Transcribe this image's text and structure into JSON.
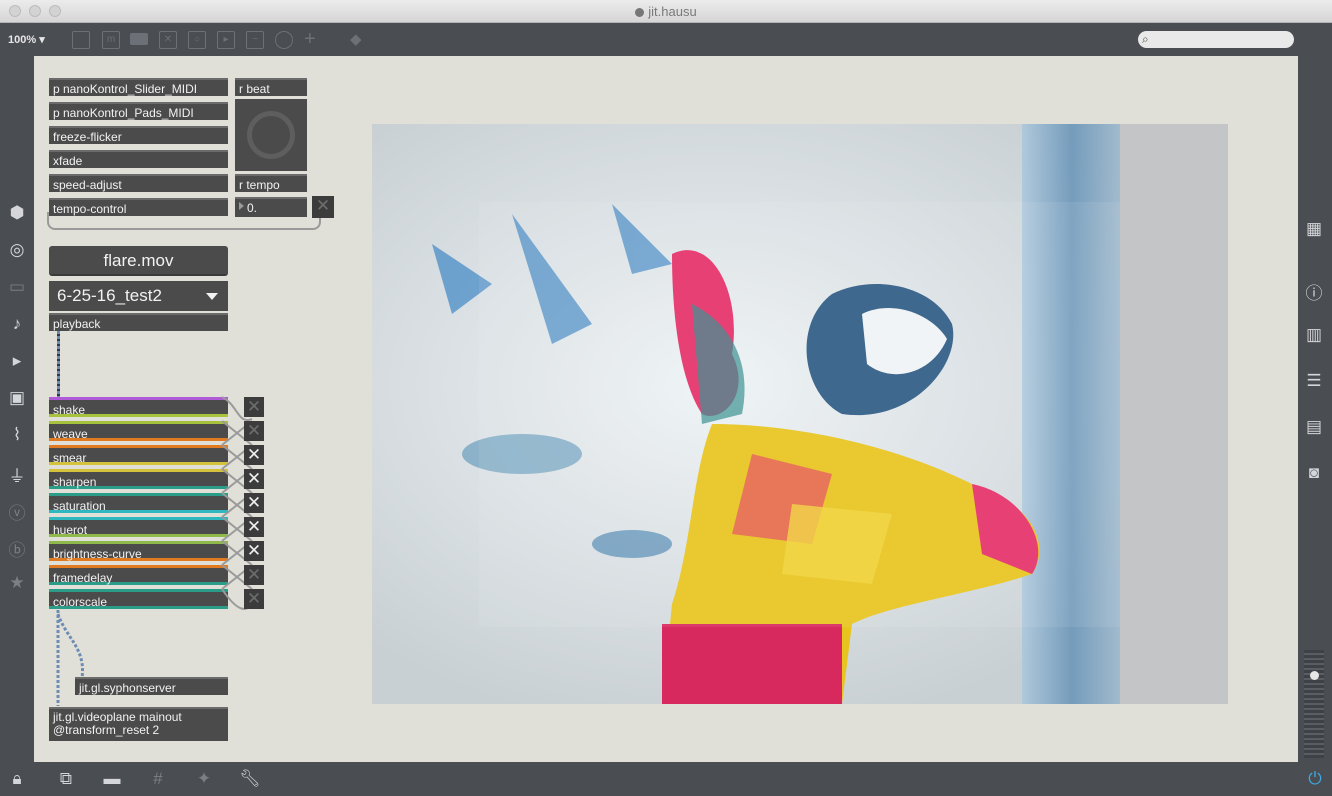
{
  "window": {
    "title": "jit.hausu"
  },
  "toolbar": {
    "zoom": "100%",
    "zoom_caret": "▾"
  },
  "left_sidebar": [
    "cube-icon",
    "target-icon",
    "bus-icon",
    "note-icon",
    "play-step-icon",
    "image-icon",
    "paperclip-icon",
    "plug-icon",
    "vimeo-icon",
    "b-icon",
    "star-icon"
  ],
  "right_sidebar": [
    "grid-icon",
    "info-icon",
    "book-icon",
    "list-icon",
    "reference-icon",
    "camera-icon"
  ],
  "patch": {
    "subpatchers": [
      "p nanoKontrol_Slider_MIDI",
      "p nanoKontrol_Pads_MIDI",
      "freeze-flicker",
      "xfade",
      "speed-adjust",
      "tempo-control"
    ],
    "r_beat": "r beat",
    "r_tempo": "r tempo",
    "number_value": "0.",
    "movie_button": "flare.mov",
    "umenu_value": "6-25-16_test2",
    "playback": "playback",
    "effects": [
      {
        "label": "shake",
        "color": "#b05ad8"
      },
      {
        "label": "weave",
        "color": "#a7c33e"
      },
      {
        "label": "smear",
        "color": "#e07b22"
      },
      {
        "label": "sharpen",
        "color": "#d5c23c"
      },
      {
        "label": "saturation",
        "color": "#2b9c88"
      },
      {
        "label": "huerot",
        "color": "#2fb8c0"
      },
      {
        "label": "brightness-curve",
        "color": "#8fb94a"
      },
      {
        "label": "framedelay",
        "color": "#e07b22"
      },
      {
        "label": "colorscale",
        "color": "#2b9c88"
      }
    ],
    "syphon": "jit.gl.syphonserver",
    "videoplane_line1": "jit.gl.videoplane mainout",
    "videoplane_line2": "@transform_reset 2"
  },
  "bottom_bar": [
    "lock-icon",
    "presentation-windows-icon",
    "presentation-icon",
    "grid-icon",
    "snap-icon",
    "wrench-icon",
    "power-icon"
  ]
}
